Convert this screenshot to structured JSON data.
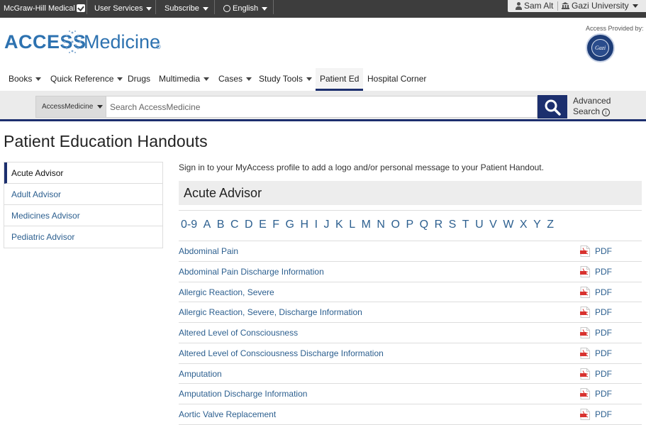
{
  "topbar": {
    "brand": "McGraw-Hill Medical",
    "user_services": "User Services",
    "subscribe": "Subscribe",
    "language": "English",
    "user_name": "Sam Alt",
    "institution": "Gazi University"
  },
  "logo": {
    "part1": "ACCESS",
    "part2": "Medicine",
    "reg": "®"
  },
  "provider": {
    "label": "Access Provided by:",
    "seal_text": "Gazi"
  },
  "nav": {
    "books": "Books",
    "quick_reference": "Quick Reference",
    "drugs": "Drugs",
    "multimedia": "Multimedia",
    "cases": "Cases",
    "study_tools": "Study Tools",
    "patient_ed": "Patient Ed",
    "hospital_corner": "Hospital Corner"
  },
  "search": {
    "scope": "AccessMedicine",
    "placeholder": "Search AccessMedicine",
    "advanced_line1": "Advanced",
    "advanced_line2": "Search"
  },
  "page": {
    "title": "Patient Education Handouts",
    "signin_message": "Sign in to your MyAccess profile to add a logo and/or personal message to your Patient Handout.",
    "section_title": "Acute Advisor"
  },
  "sidenav": [
    "Acute Advisor",
    "Adult Advisor",
    "Medicines Advisor",
    "Pediatric Advisor"
  ],
  "alphabet": [
    "0-9",
    "A",
    "B",
    "C",
    "D",
    "E",
    "F",
    "G",
    "H",
    "I",
    "J",
    "K",
    "L",
    "M",
    "N",
    "O",
    "P",
    "Q",
    "R",
    "S",
    "T",
    "U",
    "V",
    "W",
    "X",
    "Y",
    "Z"
  ],
  "handouts": [
    {
      "title": "Abdominal Pain",
      "format": "PDF"
    },
    {
      "title": "Abdominal Pain Discharge Information",
      "format": "PDF"
    },
    {
      "title": "Allergic Reaction, Severe",
      "format": "PDF"
    },
    {
      "title": "Allergic Reaction, Severe, Discharge Information",
      "format": "PDF"
    },
    {
      "title": "Altered Level of Consciousness",
      "format": "PDF"
    },
    {
      "title": "Altered Level of Consciousness Discharge Information",
      "format": "PDF"
    },
    {
      "title": "Amputation",
      "format": "PDF"
    },
    {
      "title": "Amputation Discharge Information",
      "format": "PDF"
    },
    {
      "title": "Aortic Valve Replacement",
      "format": "PDF"
    }
  ],
  "colors": {
    "navy": "#1c2f6e",
    "link": "#2c5f8f",
    "topbar": "#3d3d3d",
    "logo_blue": "#2d72b0"
  },
  "icons": {
    "search": "magnifier-icon",
    "pdf": "pdf-file-icon",
    "user": "person-icon",
    "institution": "bank-icon",
    "language": "globe-icon"
  }
}
